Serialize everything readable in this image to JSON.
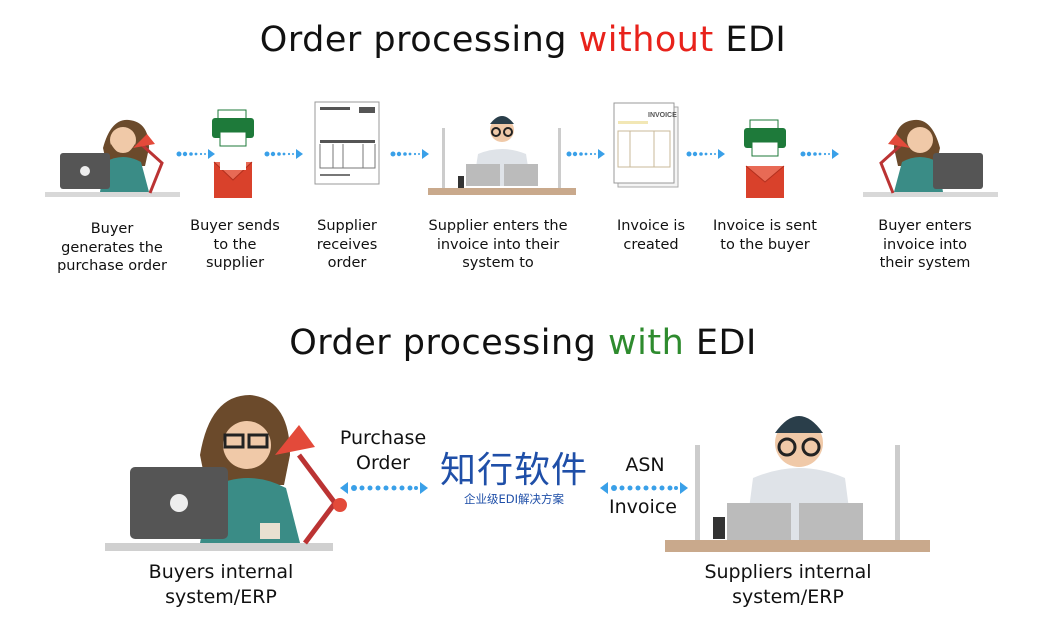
{
  "top": {
    "title_prefix": "Order processing ",
    "title_highlight": "without",
    "title_suffix": " EDI",
    "highlight_color": "#e8221b",
    "steps": [
      {
        "icon": "buyer-at-laptop",
        "label": "Buyer generates the purchase order"
      },
      {
        "icon": "printer-and-mail",
        "label": "Buyer sends to the supplier"
      },
      {
        "icon": "order-document",
        "label": "Supplier receives order"
      },
      {
        "icon": "supplier-at-desk",
        "label": "Supplier enters the invoice into their system to"
      },
      {
        "icon": "invoice-document",
        "label": "Invoice is created"
      },
      {
        "icon": "printer-and-mail",
        "label": "Invoice is sent to the buyer"
      },
      {
        "icon": "buyer-at-laptop",
        "label": "Buyer enters invoice into their system"
      }
    ]
  },
  "bottom": {
    "title_prefix": "Order processing ",
    "title_highlight": "with",
    "title_suffix": " EDI",
    "highlight_color": "#2e8b2e",
    "buyer_label": "Buyers internal system/ERP",
    "supplier_label": "Suppliers internal system/ERP",
    "left_flow_label": "Purchase Order",
    "right_flow_label_top": "ASN",
    "right_flow_label_bottom": "Invoice"
  },
  "watermark": {
    "brand": "知行软件",
    "tagline": "企业级EDI解决方案",
    "color": "#1f4fa8"
  },
  "colors": {
    "arrow": "#3aa0e8",
    "printer": "#1e7a3a",
    "mail": "#d9412b"
  }
}
